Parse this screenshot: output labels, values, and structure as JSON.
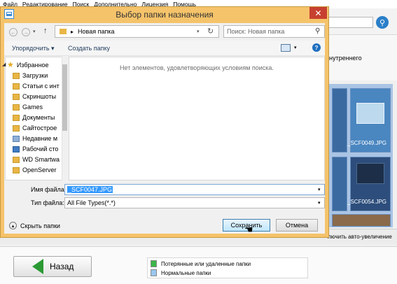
{
  "app": {
    "menu": [
      "Файл",
      "Редактирование",
      "Поиск",
      "Дополнительно",
      "Лицензия",
      "Помощь"
    ],
    "ribbon_partial_text": "нутреннего",
    "bottom_partial_text": "лючить авто-увеличение",
    "thumbnails": [
      "_SCF0049.JPG",
      "_SCF0054.JPG"
    ],
    "back_button": "Назад",
    "legend": [
      {
        "label": "Потерянные или удаленные папки",
        "color": "#3cb54a"
      },
      {
        "label": "Нормальные папки",
        "color": "#9ac7ef"
      }
    ]
  },
  "dialog": {
    "title": "Выбор папки назначения",
    "breadcrumb": "Новая папка",
    "search_placeholder": "Поиск: Новая папка",
    "organize": "Упорядочить ▾",
    "new_folder": "Создать папку",
    "tree": {
      "favorites": "Избранное",
      "items": [
        "Загрузки",
        "Статьи с инт",
        "Скриншоты",
        "Games",
        "Документы",
        "Сайтострое",
        "Недавние м",
        "Рабочий сто",
        "WD Smartwa",
        "OpenServer"
      ]
    },
    "empty_message": "Нет элементов, удовлетворяющих условиям поиска.",
    "filename_label": "Имя файла:",
    "filename_value": "_SCF0047.JPG",
    "filetype_label": "Тип файла:",
    "filetype_value": "All File Types(*.*)",
    "hide_folders": "Скрыть папки",
    "save": "Сохранить",
    "cancel": "Отмена"
  }
}
